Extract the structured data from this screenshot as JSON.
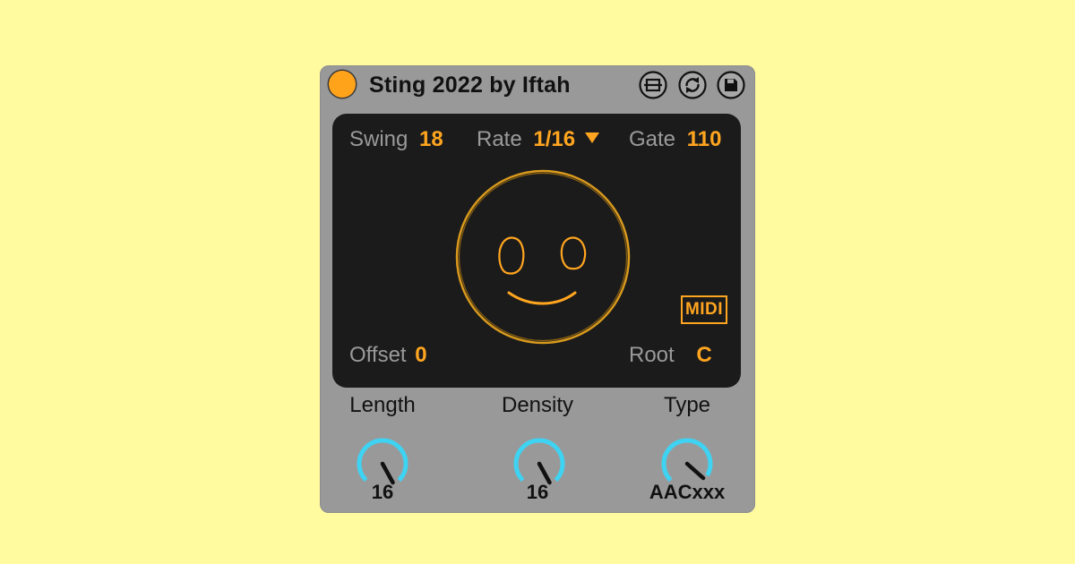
{
  "device": {
    "title": "Sting 2022 by Iftah",
    "accent": "#ffa51f",
    "knob_color": "#3ed3f2",
    "header_buttons": [
      {
        "name": "hotswap-button",
        "icon": "hotswap-icon"
      },
      {
        "name": "refresh-button",
        "icon": "refresh-icon"
      },
      {
        "name": "save-button",
        "icon": "save-icon"
      }
    ]
  },
  "params": {
    "swing": {
      "label": "Swing",
      "value": "18"
    },
    "rate": {
      "label": "Rate",
      "value": "1/16"
    },
    "gate": {
      "label": "Gate",
      "value": "110"
    },
    "offset": {
      "label": "Offset",
      "value": "0"
    },
    "root": {
      "label": "Root",
      "value": "C"
    },
    "midi_badge": "MIDI"
  },
  "knobs": [
    {
      "label": "Length",
      "value": "16"
    },
    {
      "label": "Density",
      "value": "16"
    },
    {
      "label": "Type",
      "value": "AACxxx"
    }
  ]
}
